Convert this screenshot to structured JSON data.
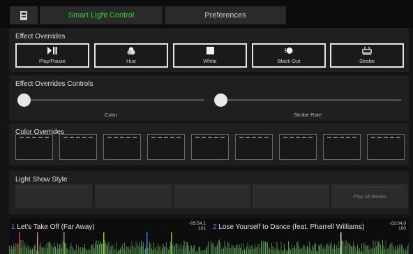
{
  "header": {
    "tabs": [
      {
        "label": "Smart Light Control",
        "active": true
      },
      {
        "label": "Preferences",
        "active": false
      }
    ]
  },
  "effect_overrides": {
    "title": "Effect Overrides",
    "buttons": [
      {
        "label": "Play/Pause",
        "icon": "play-pause-icon"
      },
      {
        "label": "Hue",
        "icon": "hue-icon"
      },
      {
        "label": "White",
        "icon": "white-square-icon"
      },
      {
        "label": "Black Out",
        "icon": "black-out-icon"
      },
      {
        "label": "Strobe",
        "icon": "strobe-icon"
      }
    ]
  },
  "effect_controls": {
    "title": "Effect Overrides Controls",
    "sliders": [
      {
        "label": "Color",
        "value": 0
      },
      {
        "label": "Strobe Rate",
        "value": 0
      }
    ]
  },
  "color_overrides": {
    "title": "Color Overrides",
    "swatch_count": 9
  },
  "light_show": {
    "title": "Light Show Style",
    "buttons": [
      "",
      "",
      "",
      "",
      "Play All Banks"
    ]
  },
  "decks": [
    {
      "number": "1",
      "title": "Let's Take Off (Far Away)",
      "time": "-05:54.1",
      "bpm": "101"
    },
    {
      "number": "2",
      "title": "Lose Yourself to Dance (feat. Pharrell Williams)",
      "time": "-02:04.0",
      "bpm": "100"
    }
  ],
  "colors": {
    "accent": "#2bd23a",
    "deck_number": "#3d8ef0",
    "waveform": "#5fa65a"
  }
}
